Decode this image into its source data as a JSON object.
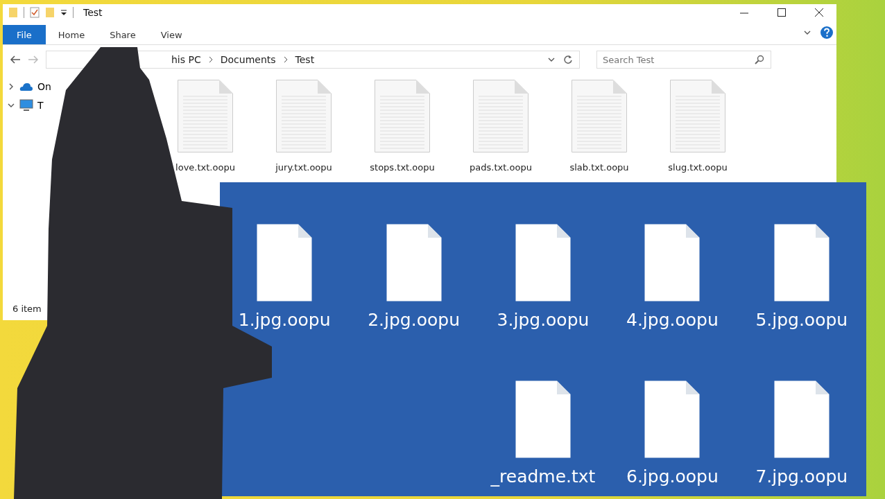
{
  "explorer": {
    "title": "Test",
    "tabs": [
      {
        "label": "File",
        "selected": true
      },
      {
        "label": "Home",
        "selected": false
      },
      {
        "label": "Share",
        "selected": false
      },
      {
        "label": "View",
        "selected": false
      }
    ],
    "breadcrumb": [
      "his PC",
      "Documents",
      "Test"
    ],
    "search": {
      "placeholder": "Search Test"
    },
    "nav": [
      {
        "label": "On",
        "kind": "cloud",
        "expanded": false
      },
      {
        "label": "T",
        "kind": "pc",
        "expanded": true
      }
    ],
    "files": [
      "love.txt.oopu",
      "jury.txt.oopu",
      "stops.txt.oopu",
      "pads.txt.oopu",
      "slab.txt.oopu",
      "slug.txt.oopu"
    ],
    "status": "6 item"
  },
  "desktop": {
    "files": [
      {
        "name": "1.jpg.oopu",
        "kind": "file"
      },
      {
        "name": "2.jpg.oopu",
        "kind": "file"
      },
      {
        "name": "3.jpg.oopu",
        "kind": "file"
      },
      {
        "name": "4.jpg.oopu",
        "kind": "file"
      },
      {
        "name": "5.jpg.oopu",
        "kind": "file"
      },
      {
        "kind": "empty"
      },
      {
        "kind": "empty"
      },
      {
        "name": "_readme.txt",
        "kind": "file"
      },
      {
        "name": "6.jpg.oopu",
        "kind": "file"
      },
      {
        "name": "7.jpg.oopu",
        "kind": "file"
      }
    ]
  }
}
